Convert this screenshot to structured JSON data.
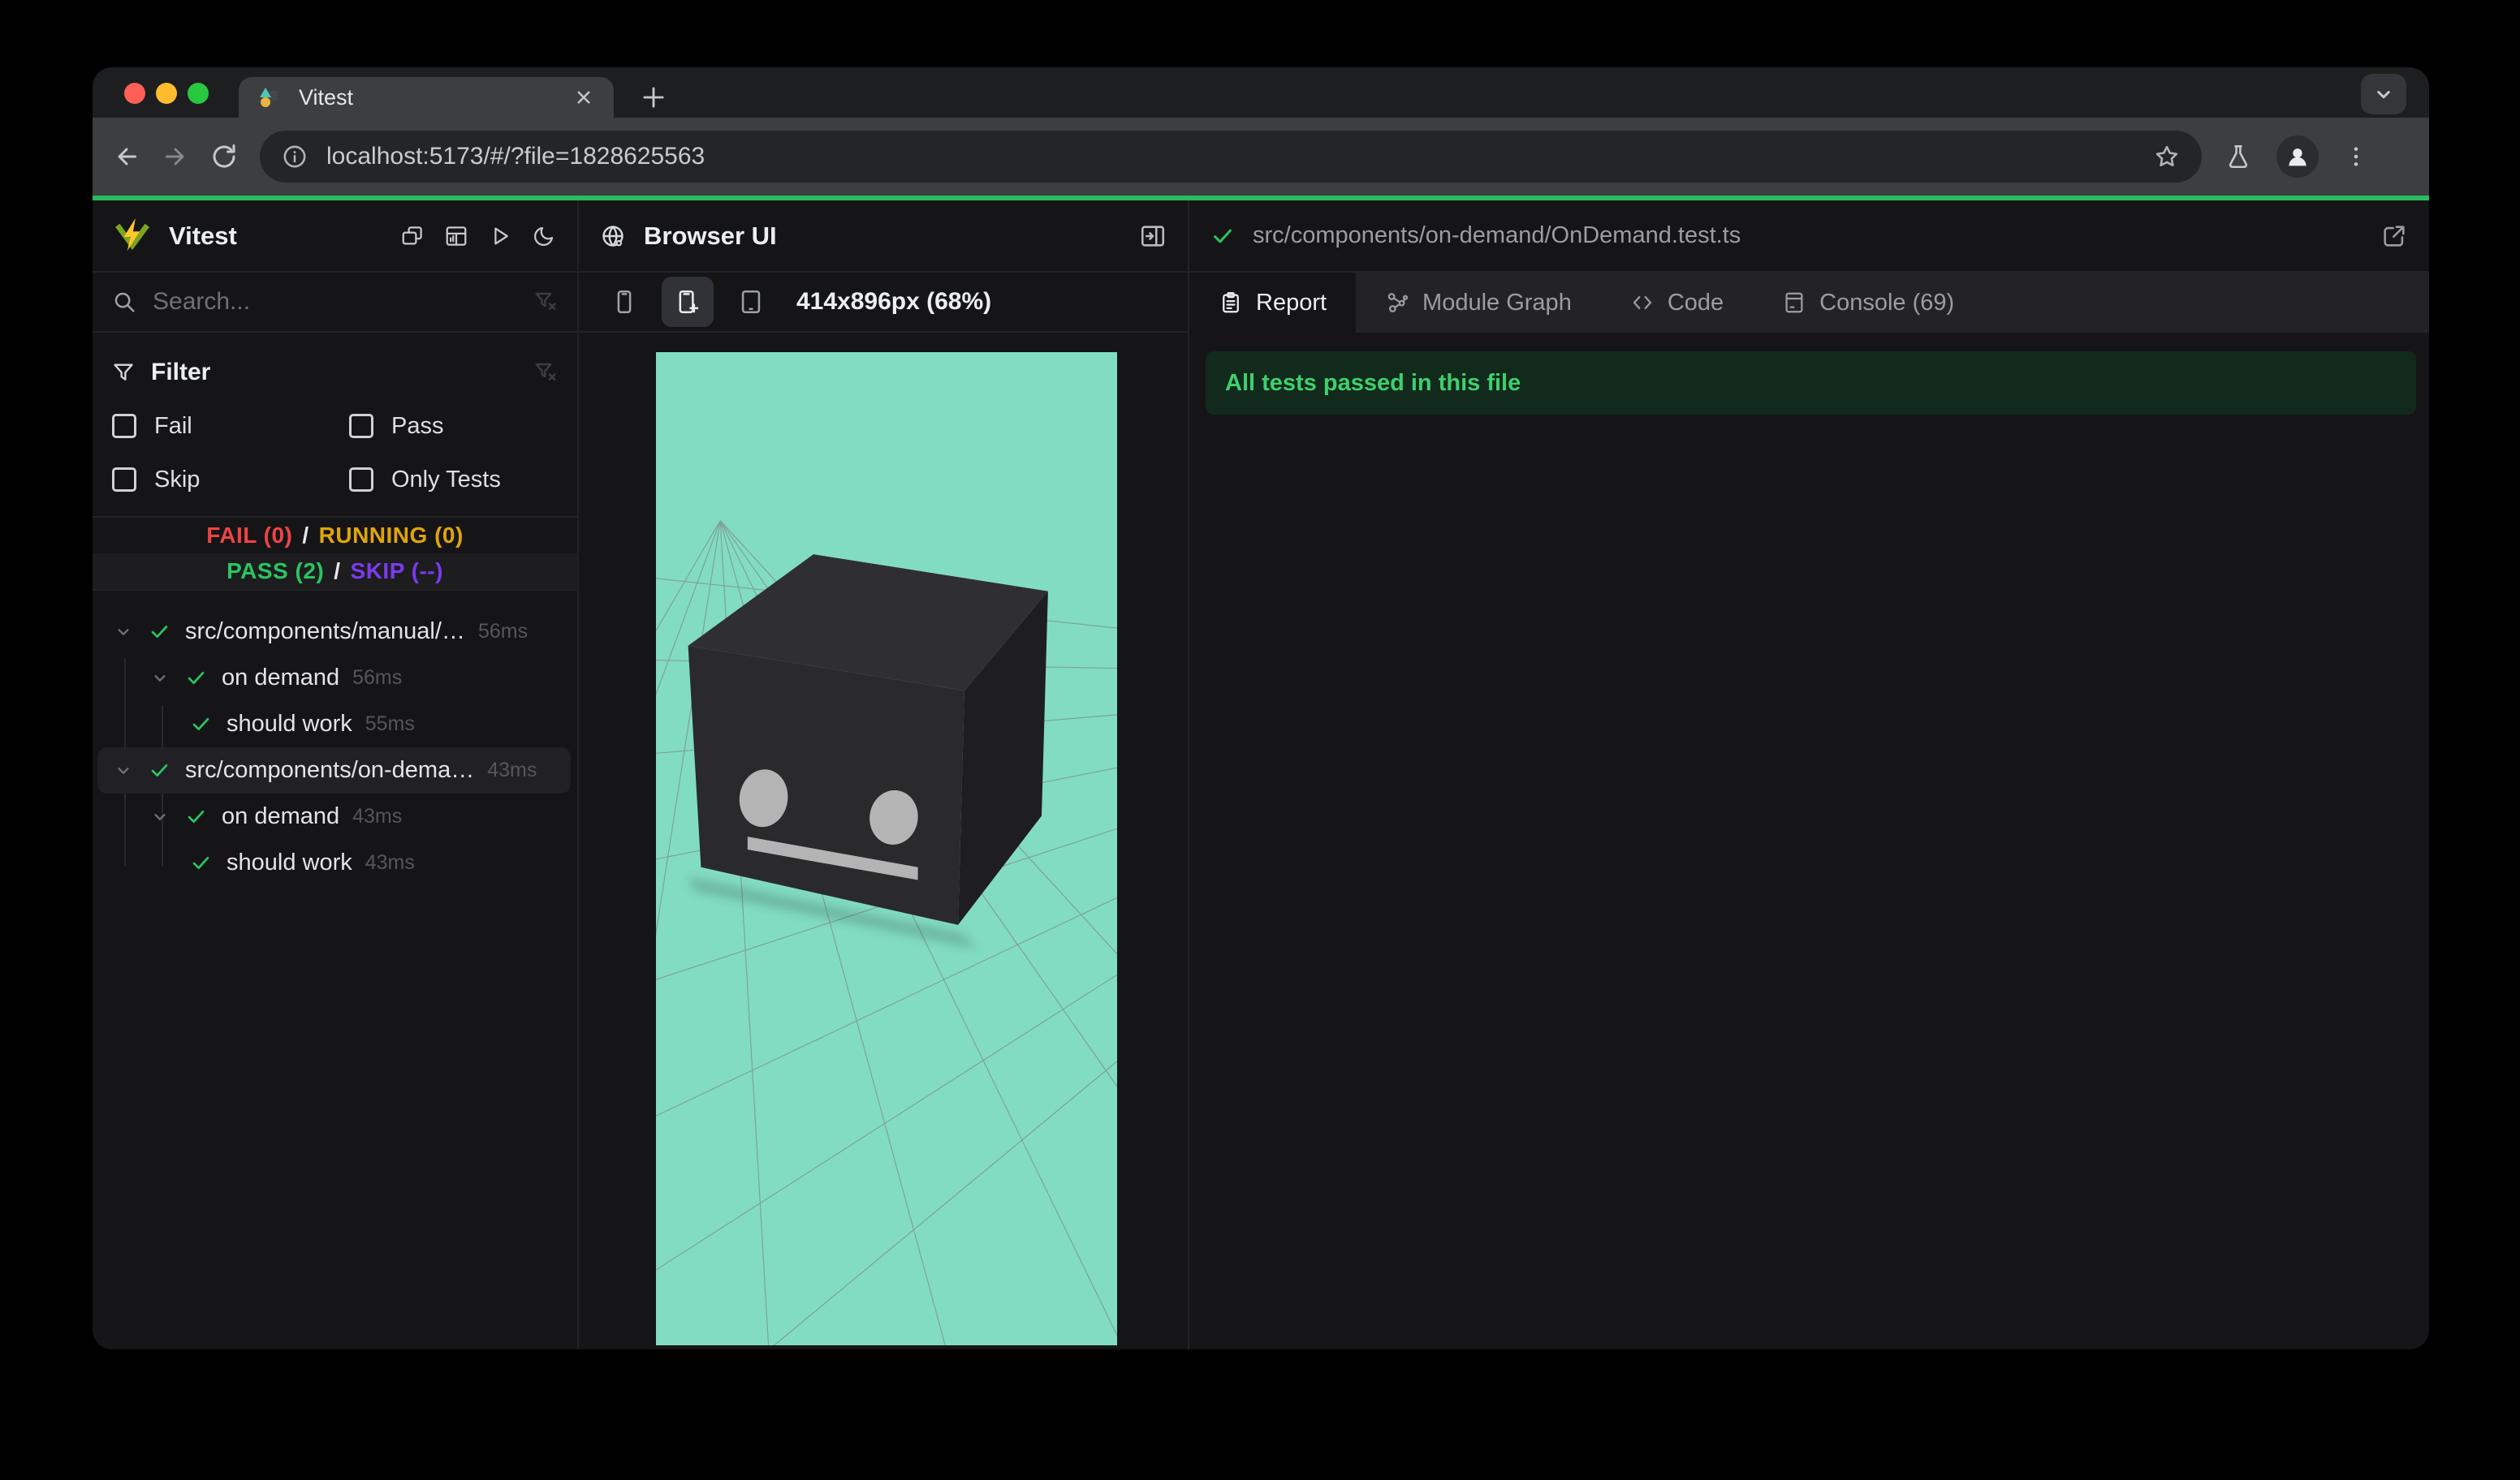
{
  "window": {
    "tab_title": "Vitest",
    "url": "localhost:5173/#/?file=1828625563"
  },
  "sidebar": {
    "app_title": "Vitest",
    "header_icons": [
      "windows-icon",
      "dashboard-icon",
      "play-icon",
      "moon-icon"
    ],
    "search": {
      "placeholder": "Search..."
    },
    "filter": {
      "label": "Filter",
      "options": [
        {
          "label": "Fail",
          "checked": false
        },
        {
          "label": "Pass",
          "checked": false
        },
        {
          "label": "Skip",
          "checked": false
        },
        {
          "label": "Only Tests",
          "checked": false
        }
      ]
    },
    "status": {
      "fail": "FAIL (0)",
      "running": "RUNNING (0)",
      "pass": "PASS (2)",
      "skip": "SKIP (--)",
      "separator": "/"
    },
    "tree": [
      {
        "label": "src/components/manual/…",
        "time": "56ms",
        "level": 0,
        "expandable": true,
        "status": "pass",
        "selected": false
      },
      {
        "label": "on demand",
        "time": "56ms",
        "level": 1,
        "expandable": true,
        "status": "pass",
        "selected": false
      },
      {
        "label": "should work",
        "time": "55ms",
        "level": 2,
        "expandable": false,
        "status": "pass",
        "selected": false
      },
      {
        "label": "src/components/on-dema…",
        "time": "43ms",
        "level": 0,
        "expandable": true,
        "status": "pass",
        "selected": true
      },
      {
        "label": "on demand",
        "time": "43ms",
        "level": 1,
        "expandable": true,
        "status": "pass",
        "selected": false
      },
      {
        "label": "should work",
        "time": "43ms",
        "level": 2,
        "expandable": false,
        "status": "pass",
        "selected": false
      }
    ]
  },
  "preview": {
    "title": "Browser UI",
    "device_buttons": [
      {
        "icon": "phone-small-icon",
        "active": false
      },
      {
        "icon": "phone-plus-icon",
        "active": true
      },
      {
        "icon": "tablet-icon",
        "active": false
      }
    ],
    "size_label": "414x896px (68%)"
  },
  "report": {
    "file_path": "src/components/on-demand/OnDemand.test.ts",
    "tabs": [
      {
        "label": "Report",
        "icon": "clipboard-icon",
        "active": true
      },
      {
        "label": "Module Graph",
        "icon": "module-graph-icon",
        "active": false
      },
      {
        "label": "Code",
        "icon": "code-icon",
        "active": false
      },
      {
        "label": "Console (69)",
        "icon": "console-icon",
        "active": false
      }
    ],
    "banner": "All tests passed in this file"
  },
  "colors": {
    "accent_green": "#2abd5e",
    "fail_red": "#ef4444",
    "running_yellow": "#dfa50b",
    "pass_green": "#2bc560",
    "skip_purple": "#7c3aed",
    "banner_bg": "#122a1c",
    "banner_text": "#3fcf6e",
    "viewport_bg": "#82dcc2",
    "grid_line": "#7d8f89",
    "cube_top": "#2f2f31",
    "cube_front": "#2a2a2c",
    "cube_right": "#1e1e20",
    "cube_face_features": "#b4b4b4",
    "traffic_red": "#ff5f57",
    "traffic_yellow": "#febc2e",
    "traffic_green": "#28c840",
    "logo_bolt": "#fcc72b",
    "logo_v": "#7ca41f",
    "favicon_teal": "#4fc7b7",
    "favicon_yellow": "#e9b53e"
  }
}
